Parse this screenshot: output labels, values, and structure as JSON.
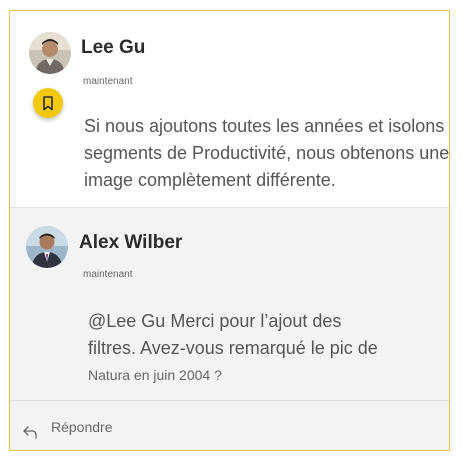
{
  "comments": [
    {
      "author": "Lee Gu",
      "time": "maintenant",
      "lines": [
        "Si nous ajoutons toutes les années et isolons",
        "segments de Productivité, nous obtenons une",
        "image complètement différente."
      ]
    },
    {
      "author": "Alex Wilber",
      "time": "maintenant",
      "mention": "@Lee Gu",
      "line1_rest": " Merci pour l’ajout des",
      "line2": "filtres. Avez-vous remarqué le pic de",
      "line3": "Natura en juin 2004 ?"
    }
  ],
  "footer": {
    "reply_label": "Répondre"
  },
  "icons": {
    "bookmark": "bookmark-icon",
    "reply": "reply-icon"
  },
  "colors": {
    "accent": "#f2c811",
    "border": "#e3c44a"
  }
}
